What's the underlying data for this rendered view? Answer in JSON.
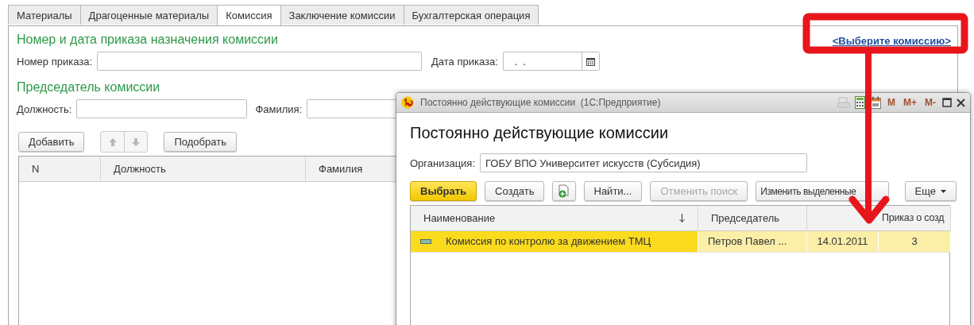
{
  "tabs": [
    {
      "label": "Материалы",
      "selected": false
    },
    {
      "label": "Драгоценные материалы",
      "selected": false
    },
    {
      "label": "Комиссия",
      "selected": true
    },
    {
      "label": "Заключение комиссии",
      "selected": false
    },
    {
      "label": "Бухгалтерская операция",
      "selected": false
    }
  ],
  "order_section": {
    "heading": "Номер и дата приказа назначения комиссии",
    "select_link": "<Выберите комиссию>",
    "order_number": {
      "label": "Номер приказа:"
    },
    "order_date": {
      "label": "Дата приказа:",
      "value": " .  ."
    }
  },
  "chairman_section": {
    "heading": "Председатель комиссии",
    "position": {
      "label": "Должность:"
    },
    "surname": {
      "label": "Фамилия:"
    }
  },
  "members_toolbar": {
    "add_button": "Добавить",
    "pick_button": "Подобрать"
  },
  "members_table": {
    "columns": [
      "N",
      "Должность",
      "Фамилия"
    ]
  },
  "dialog": {
    "title": "Постоянно действующие комиссии  (1С:Предприятие)",
    "memory_buttons": [
      "M",
      "M+",
      "M-"
    ],
    "heading": "Постоянно действующие комиссии",
    "organization": {
      "label": "Организация:",
      "value": "ГОБУ ВПО Университет искусств (Субсидия)"
    },
    "toolbar": [
      {
        "kind": "primary",
        "label": "Выбрать",
        "disabled": false
      },
      {
        "kind": "text",
        "label": "Создать",
        "disabled": false
      },
      {
        "kind": "icon",
        "disabled": false
      },
      {
        "kind": "text",
        "label": "Найти...",
        "disabled": false
      },
      {
        "kind": "text",
        "label": "Отменить поиск",
        "disabled": true
      },
      {
        "kind": "text",
        "label": "Изменить выделенные",
        "disabled": false
      },
      {
        "kind": "menu",
        "label": "Еще",
        "disabled": false
      }
    ],
    "table": {
      "columns": [
        {
          "label": "Наименование",
          "sorted": true
        },
        {
          "label": "Председатель",
          "sorted": false
        },
        {
          "sorted": false
        },
        {
          "label": "Приказ о созд",
          "sorted": false
        }
      ],
      "rows": [
        {
          "selected": true,
          "cells": [
            "Комиссия по контролю за движением ТМЦ",
            "Петров Павел ...",
            "14.01.2011",
            "3"
          ]
        }
      ]
    }
  }
}
